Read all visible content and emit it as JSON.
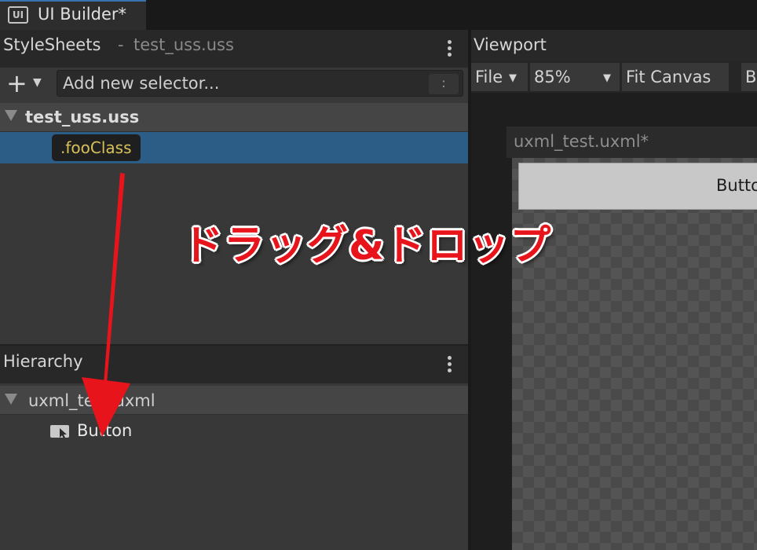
{
  "window": {
    "tab_title": "UI Builder*",
    "tab_icon": "ui-builder-icon"
  },
  "stylesheets": {
    "title": "StyleSheets",
    "separator": "-",
    "active_file": "test_uss.uss",
    "add_selector_placeholder": "Add new selector...",
    "options_glyph": ":",
    "tree": [
      {
        "label": "test_uss.uss",
        "expanded": true,
        "children": [
          {
            "label": ".fooClass",
            "selected": true
          }
        ]
      }
    ]
  },
  "hierarchy": {
    "title": "Hierarchy",
    "root": {
      "label": "uxml_test.uxml",
      "expanded": true
    },
    "children": [
      {
        "label": "Button",
        "icon": "button-element-icon"
      }
    ]
  },
  "viewport": {
    "title": "Viewport",
    "toolbar": {
      "file_label": "File",
      "zoom_label": "85%",
      "fit_label": "Fit Canvas",
      "more_label": "B"
    },
    "document_title": "uxml_test.uxml*",
    "canvas_button_label": "Button"
  },
  "annotation": {
    "text": "ドラッグ&ドロップ",
    "color": "#e8141c"
  },
  "colors": {
    "selection": "#2c5d87",
    "class_pill_text": "#d8c05a",
    "arrow": "#e8141c"
  }
}
